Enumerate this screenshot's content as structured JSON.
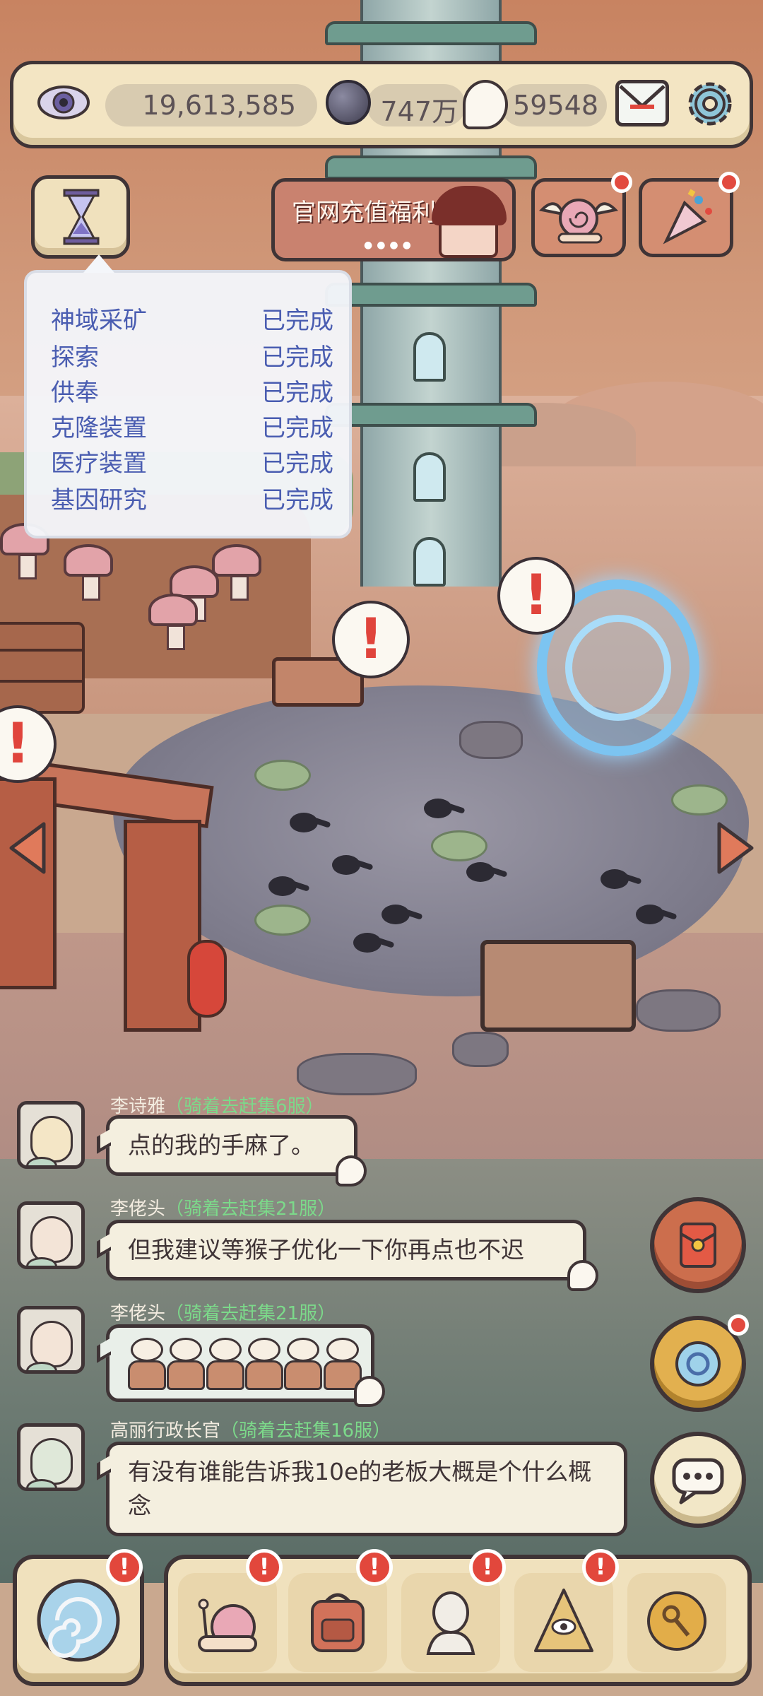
{
  "resources": {
    "eye": "19,613,585",
    "orb": "747万",
    "ghost": "59548"
  },
  "banner": {
    "title": "官网充值福利",
    "dots": "●●●●"
  },
  "tasks": [
    {
      "name": "神域采矿",
      "status": "已完成"
    },
    {
      "name": "探索",
      "status": "已完成"
    },
    {
      "name": "供奉",
      "status": "已完成"
    },
    {
      "name": "克隆装置",
      "status": "已完成"
    },
    {
      "name": "医疗装置",
      "status": "已完成"
    },
    {
      "name": "基因研究",
      "status": "已完成"
    }
  ],
  "alert_mark": "!",
  "chat": [
    {
      "name": "李诗雅",
      "server": "（骑着去赶集6服）",
      "text": "点的我的手麻了。"
    },
    {
      "name": "李佬头",
      "server": "（骑着去赶集21服）",
      "text": "但我建议等猴子优化一下你再点也不迟"
    },
    {
      "name": "李佬头",
      "server": "（骑着去赶集21服）",
      "text": ""
    },
    {
      "name": "高丽行政长官",
      "server": "（骑着去赶集16服）",
      "text": "有没有谁能告诉我10e的老板大概是个什么概念"
    }
  ],
  "colors": {
    "accent_red": "#e24a3f",
    "task_text": "#4a5db1",
    "server_green": "#7cd98a",
    "panel_cream": "#f0e1bd"
  },
  "icons": {
    "top": [
      "eye-icon",
      "dark-orb-icon",
      "ghost-icon",
      "mail-icon",
      "gear-icon"
    ],
    "row2": [
      "hourglass-icon",
      "snail-wings-icon",
      "party-popper-icon"
    ],
    "right": [
      "red-envelope-icon",
      "portal-ring-icon",
      "chat-icon"
    ],
    "dock": [
      "vortex-icon",
      "snail-icon",
      "backpack-icon",
      "statue-bust-icon",
      "pyramid-eye-icon",
      "key-coin-icon"
    ]
  }
}
